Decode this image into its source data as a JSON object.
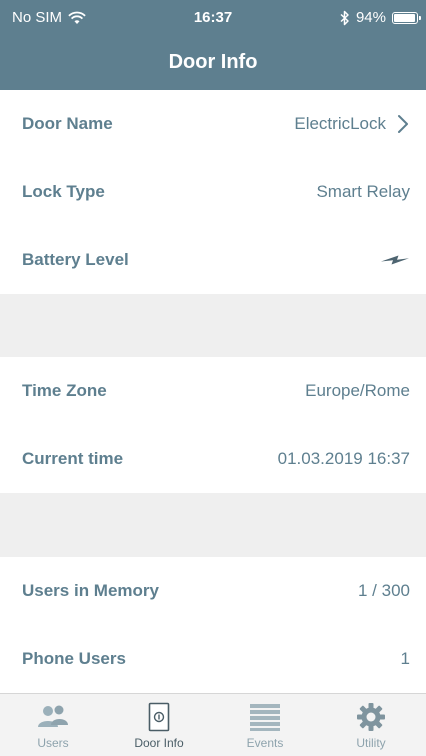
{
  "status_bar": {
    "carrier": "No SIM",
    "time": "16:37",
    "battery": "94%",
    "battery_level": 0.94
  },
  "nav": {
    "title": "Door Info"
  },
  "rows": [
    {
      "label": "Door Name",
      "value": "ElectricLock"
    },
    {
      "label": "Lock Type",
      "value": "Smart Relay"
    },
    {
      "label": "Battery Level"
    },
    {
      "label": "Time Zone",
      "value": "Europe/Rome"
    },
    {
      "label": "Current time",
      "value": "01.03.2019 16:37"
    },
    {
      "label": "Users in Memory",
      "value": "1 / 300"
    },
    {
      "label": "Phone Users",
      "value": "1"
    }
  ],
  "tabs": [
    {
      "label": "Users",
      "icon": "users-icon"
    },
    {
      "label": "Door Info",
      "icon": "door-icon",
      "active": true
    },
    {
      "label": "Events",
      "icon": "events-list-icon"
    },
    {
      "label": "Utility",
      "icon": "gear-icon"
    }
  ],
  "colors": {
    "header": "#5e7f8f",
    "text": "#5e7f8f",
    "separator_band": "#efefef",
    "tab_inactive": "#8ea3ad",
    "tab_active": "#4a5d66"
  }
}
